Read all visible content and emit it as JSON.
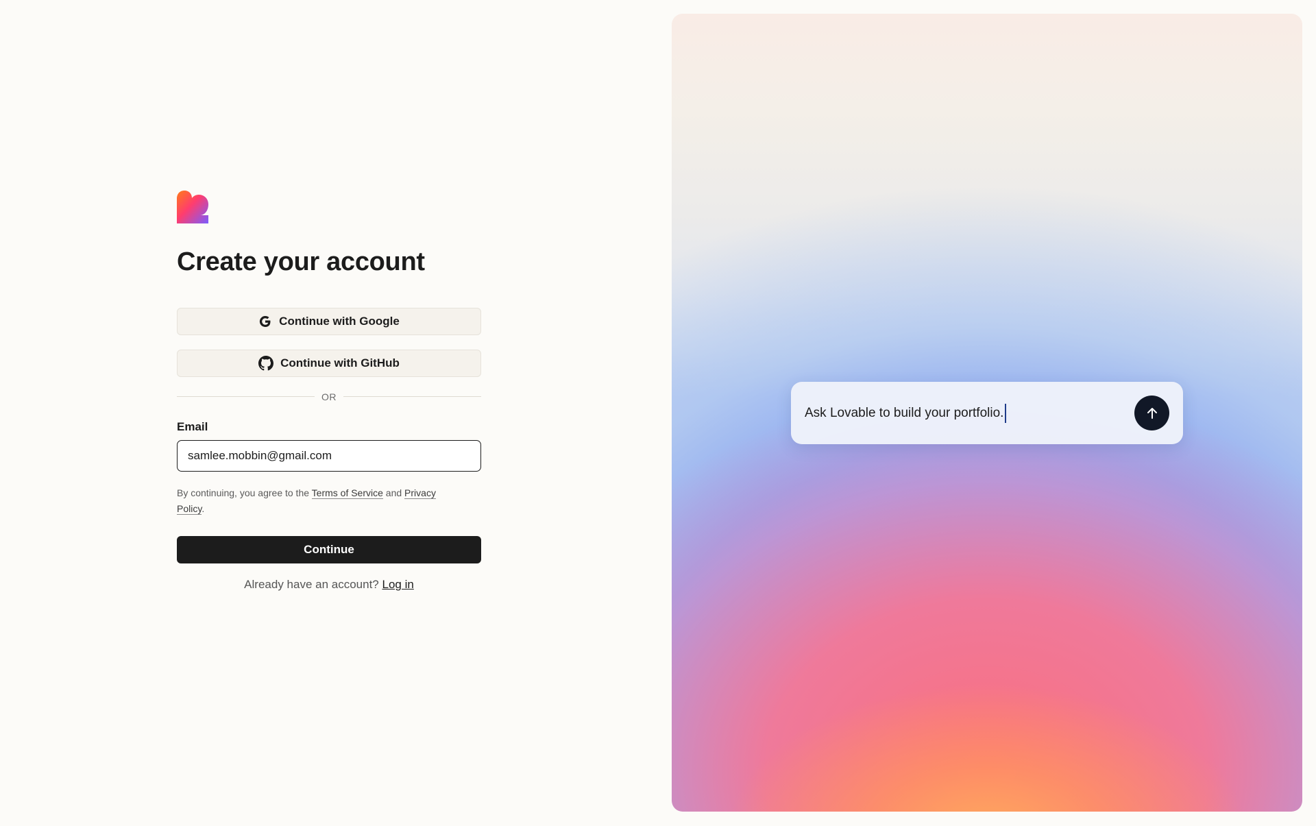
{
  "brand": {
    "logo_icon": "lovable-heart-logo"
  },
  "signup": {
    "title": "Create your account",
    "google_button": "Continue with Google",
    "github_button": "Continue with GitHub",
    "divider_text": "OR",
    "email_label": "Email",
    "email_value": "samlee.mobbin@gmail.com",
    "terms_prefix": "By continuing, you agree to the ",
    "terms_link": "Terms of Service",
    "terms_and": " and ",
    "privacy_link": "Privacy Policy",
    "terms_suffix": ".",
    "continue_button": "Continue",
    "login_prompt": "Already have an account? ",
    "login_link": "Log in"
  },
  "hero": {
    "prompt_text": "Ask Lovable to build your portfolio.",
    "send_icon": "arrow-up-icon"
  },
  "colors": {
    "background": "#fcfbf8",
    "primary_button": "#1c1c1c",
    "oauth_button": "#f5f2ec",
    "send_button": "#111827"
  }
}
